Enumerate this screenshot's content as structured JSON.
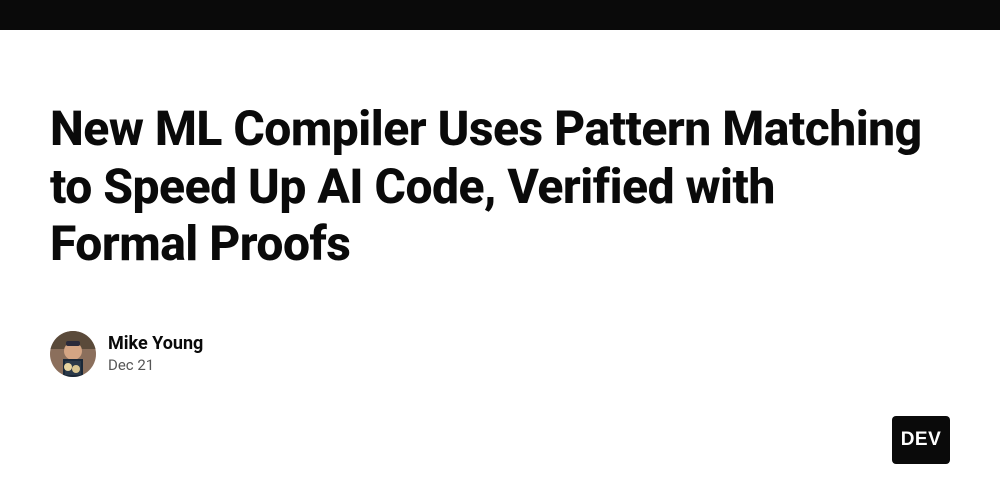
{
  "article": {
    "title": "New ML Compiler Uses Pattern Matching to Speed Up AI Code, Verified with Formal Proofs"
  },
  "author": {
    "name": "Mike Young",
    "date": "Dec 21"
  },
  "badge": {
    "label": "DEV"
  }
}
